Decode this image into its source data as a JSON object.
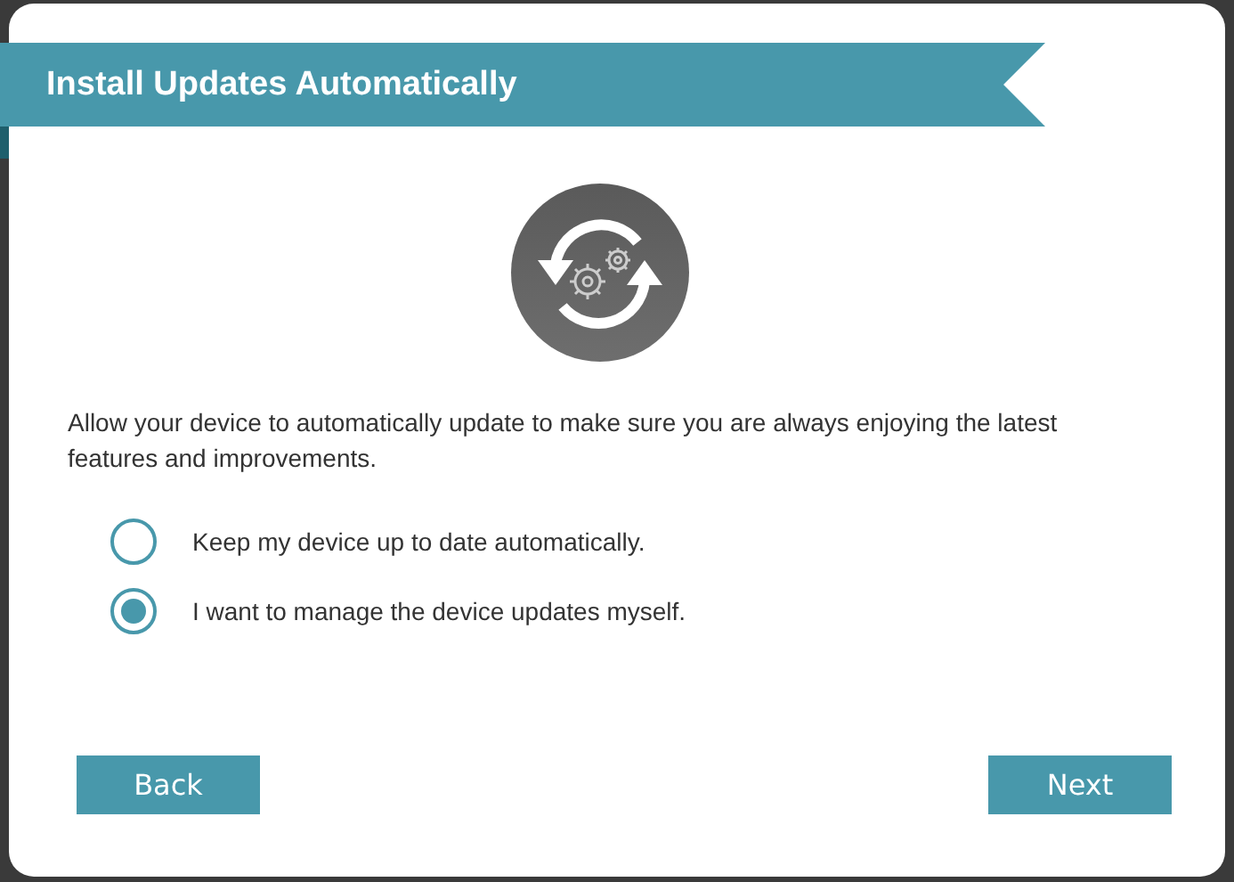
{
  "title": "Install Updates Automatically",
  "description": "Allow your device to automatically update to make sure you are always enjoying the latest features and improvements.",
  "options": [
    {
      "label": "Keep my device up to date automatically.",
      "selected": false
    },
    {
      "label": "I want to manage the device updates myself.",
      "selected": true
    }
  ],
  "buttons": [
    {
      "label": "Back"
    },
    {
      "label": "Next"
    }
  ]
}
